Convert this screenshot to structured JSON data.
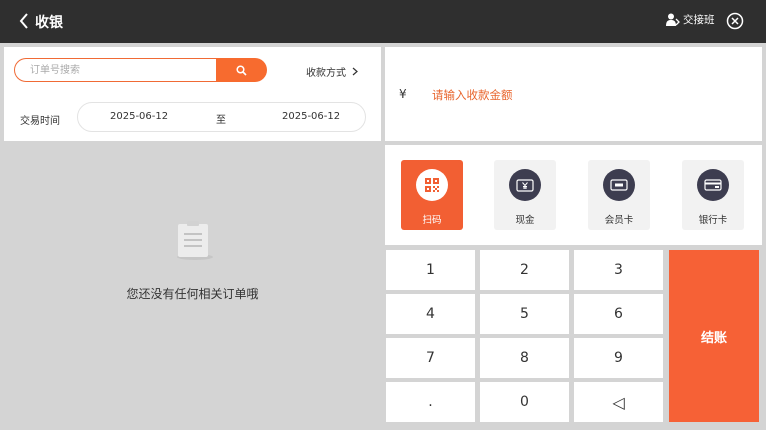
{
  "header": {
    "title": "收银",
    "handover_label": "交接班"
  },
  "search": {
    "placeholder": "订单号搜索",
    "pay_method_label": "收款方式"
  },
  "date_filter": {
    "label": "交易时间",
    "start": "2025-06-12",
    "separator": "至",
    "end": "2025-06-12"
  },
  "empty_state": {
    "message": "您还没有任何相关订单哦"
  },
  "amount": {
    "currency": "¥",
    "placeholder": "请输入收款金额"
  },
  "payment_methods": [
    {
      "label": "扫码",
      "icon": "qr-code-icon"
    },
    {
      "label": "现金",
      "icon": "cash-icon"
    },
    {
      "label": "会员卡",
      "icon": "vip-card-icon"
    },
    {
      "label": "银行卡",
      "icon": "bank-card-icon"
    }
  ],
  "selected_method": "扫码",
  "keypad": {
    "keys": [
      [
        "1",
        "2",
        "3"
      ],
      [
        "4",
        "5",
        "6"
      ],
      [
        "7",
        "8",
        "9"
      ],
      [
        ".",
        "0",
        "◁"
      ]
    ],
    "checkout_label": "结账"
  },
  "colors": {
    "accent": "#f66136",
    "topbar": "#2f2f2f",
    "icon_bg": "#3d3d50"
  }
}
